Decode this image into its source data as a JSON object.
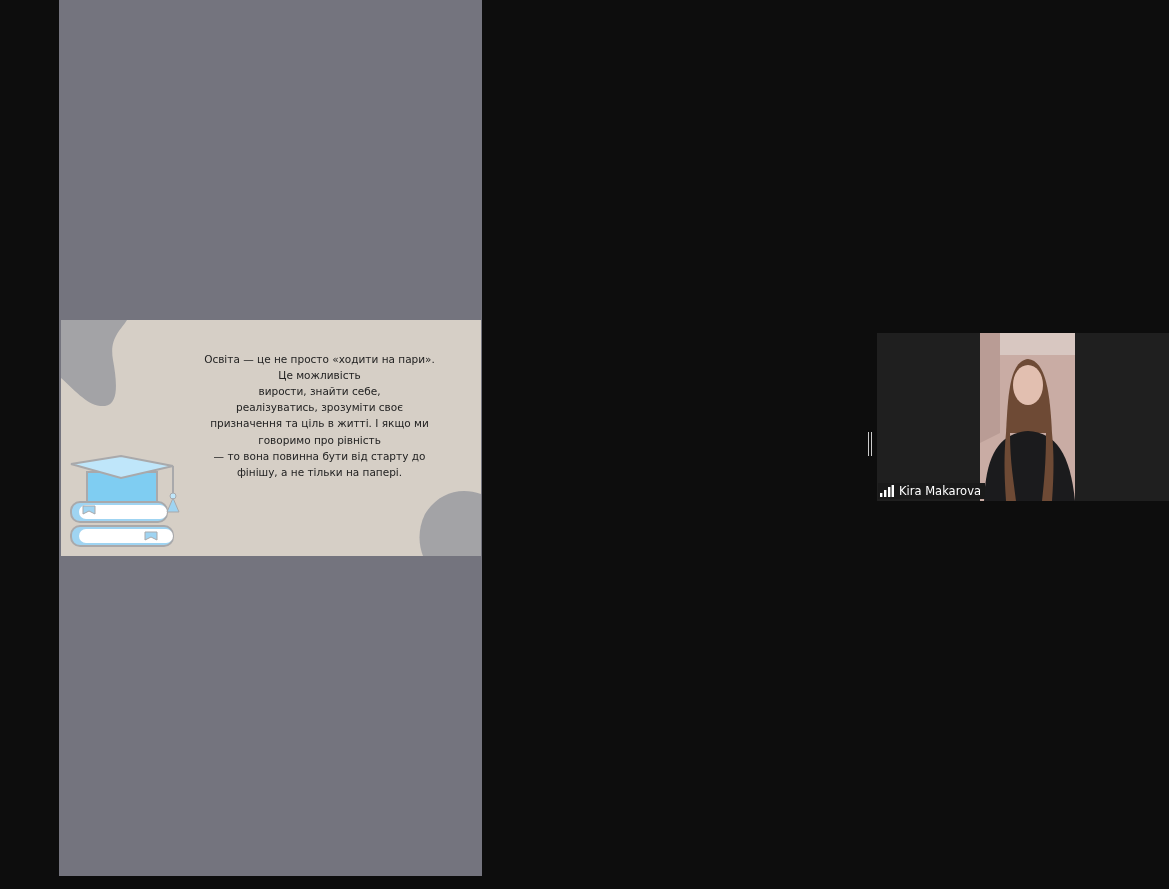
{
  "shared_screen": {
    "slide": {
      "kind": "slide",
      "text_lines": [
        "Освіта — це не просто «ходити на пари».",
        "Це можливість",
        "вирости, знайти себе,",
        "реалізуватись, зрозуміти своє",
        "призначення та ціль в житті. І якщо ми",
        "говоримо про рівність",
        "— то вона повинна бути від старту до",
        "фінішу, а не тільки на папері."
      ]
    }
  },
  "video_tiles": [
    {
      "name": "Kira Makarova"
    }
  ]
}
